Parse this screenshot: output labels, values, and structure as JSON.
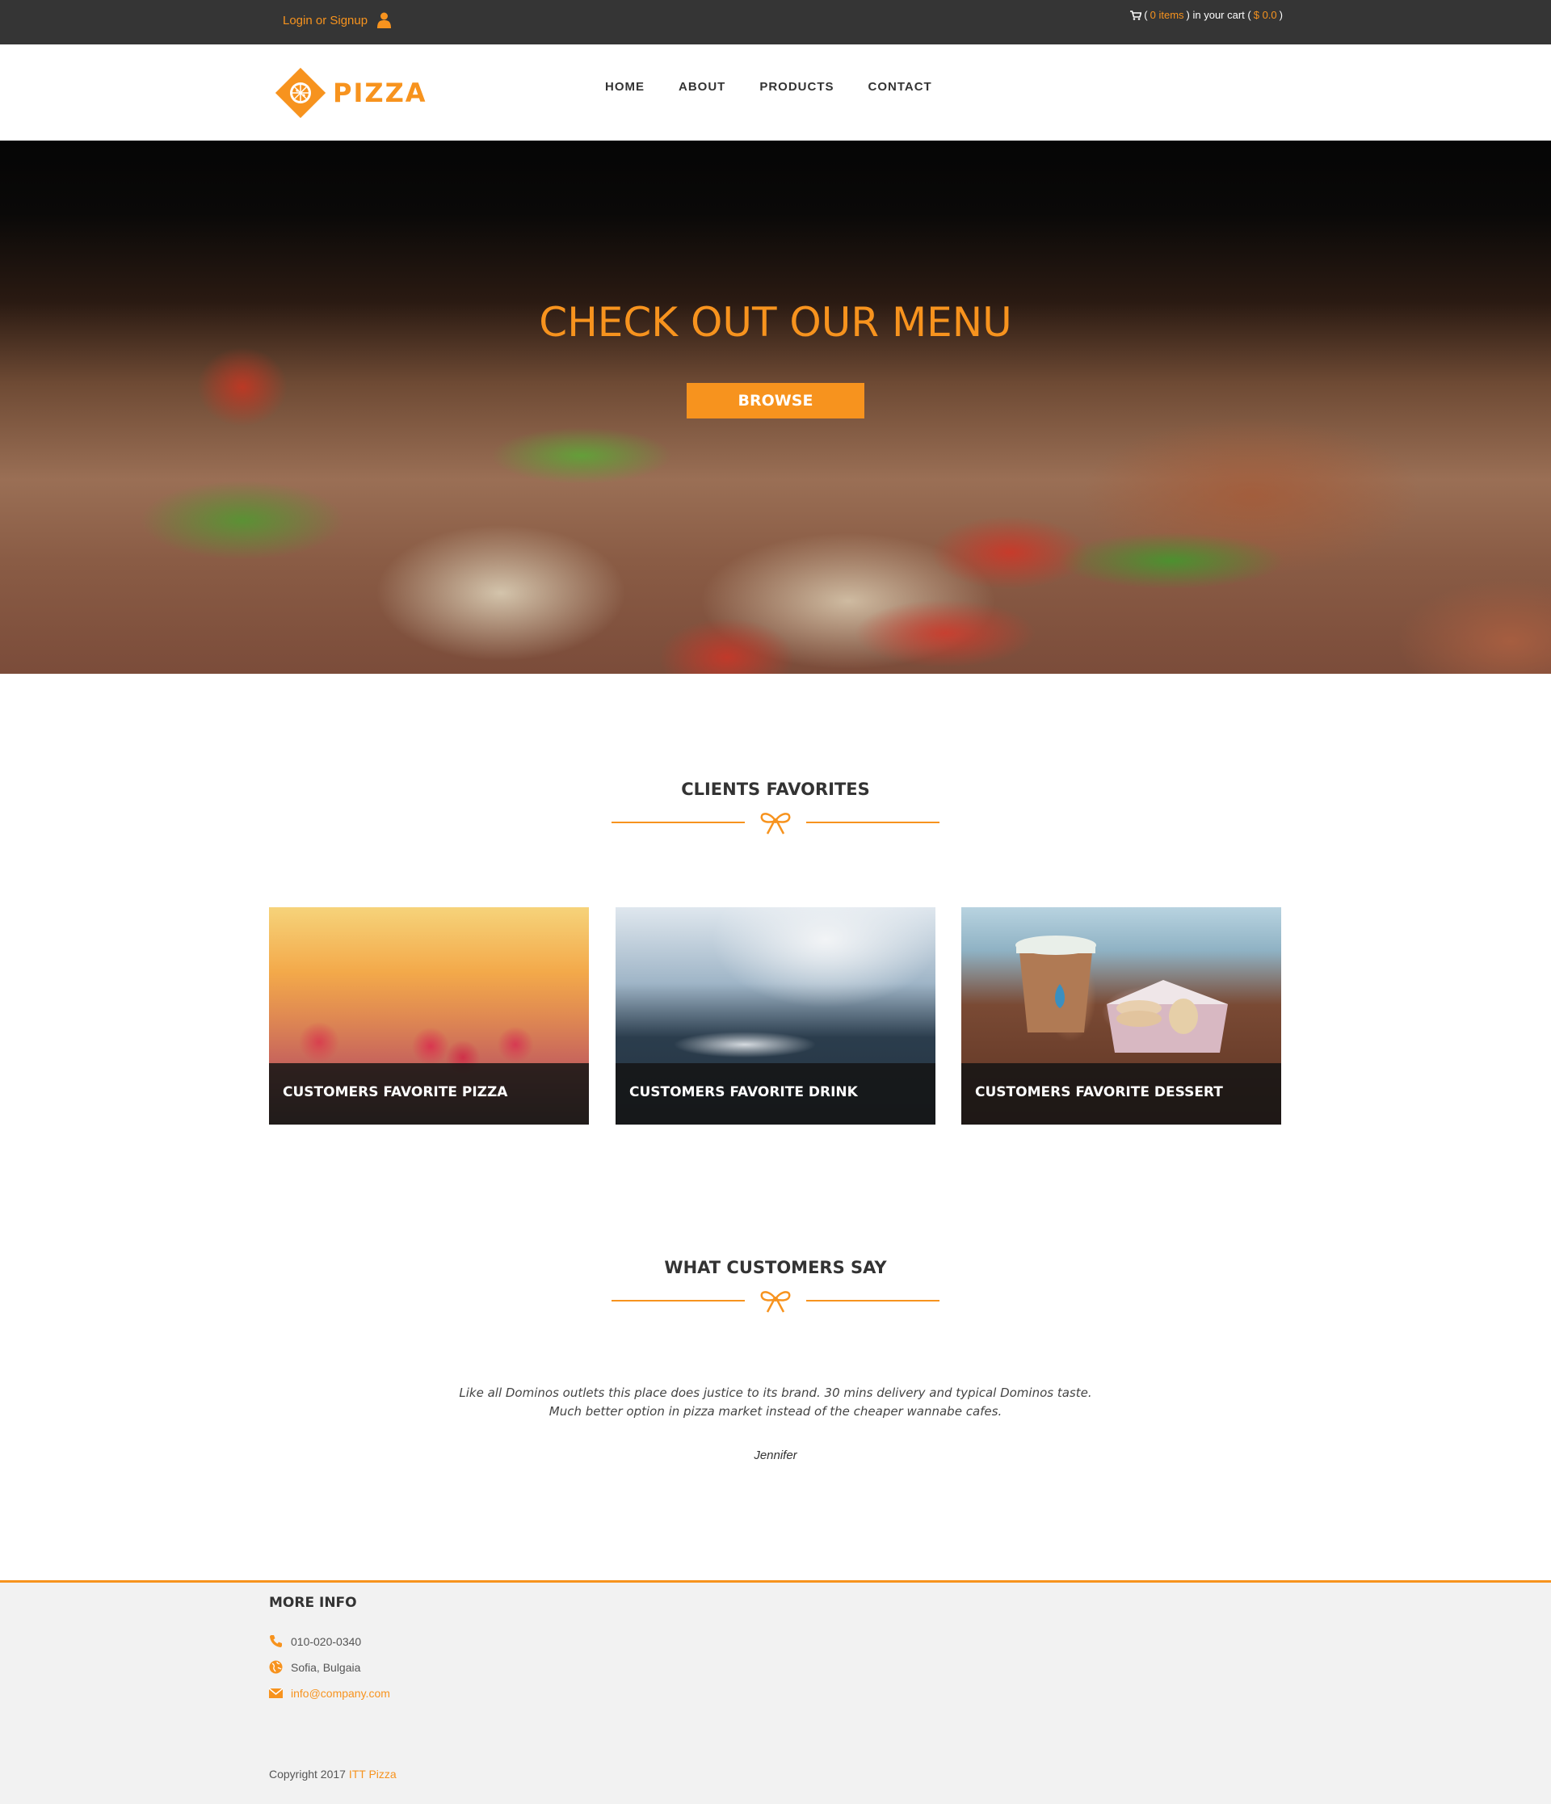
{
  "topbar": {
    "login_label": "Login or Signup",
    "user_icon": "user-icon",
    "cart_icon": "shopping-cart-icon",
    "cart_open": "(",
    "cart_items": "0 items",
    "cart_mid": ") in your cart (",
    "cart_total": "$ 0.0",
    "cart_close": ")"
  },
  "header": {
    "logo_text": "PIZZA",
    "logo_icon": "pizza-logo-icon",
    "nav": [
      "HOME",
      "ABOUT",
      "PRODUCTS",
      "CONTACT"
    ]
  },
  "hero": {
    "title": "CHECK OUT OUR MENU",
    "button_label": "BROWSE"
  },
  "favorites": {
    "title": "CLIENTS FAVORITES",
    "divider_icon": "ribbon-bow-icon",
    "cards": [
      {
        "caption": "CUSTOMERS FAVORITE PIZZA"
      },
      {
        "caption": "CUSTOMERS FAVORITE DRINK"
      },
      {
        "caption": "CUSTOMERS FAVORITE DESSERT"
      }
    ]
  },
  "testimonials": {
    "title": "WHAT CUSTOMERS SAY",
    "divider_icon": "ribbon-bow-icon",
    "quote": "Like all Dominos outlets this place does justice to its brand. 30 mins delivery and typical Dominos taste. Much better option in pizza market instead of the cheaper wannabe cafes.",
    "author": "Jennifer"
  },
  "footer": {
    "title": "MORE INFO",
    "phone": "010-020-0340",
    "phone_icon": "phone-icon",
    "location": "Sofia, Bulgaia",
    "location_icon": "globe-icon",
    "email": "info@company.com",
    "email_icon": "envelope-icon",
    "copyright_prefix": "Copyright 2017 ",
    "copyright_brand": "ITT Pizza"
  },
  "colors": {
    "accent": "#f7931e",
    "topbar_bg": "#353535",
    "footer_bg": "#f2f2f2"
  }
}
